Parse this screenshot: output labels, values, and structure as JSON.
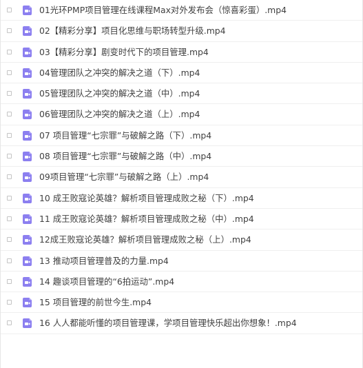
{
  "files": [
    {
      "name": "01光环PMP项目管理在线课程Max对外发布会（惊喜彩蛋）.mp4",
      "icon": "video-file-icon"
    },
    {
      "name": "02【精彩分享】项目化思维与职场转型升级.mp4",
      "icon": "video-file-icon"
    },
    {
      "name": "03【精彩分享】剧变时代下的项目管理.mp4",
      "icon": "video-file-icon"
    },
    {
      "name": "04管理团队之冲突的解决之道（下）.mp4",
      "icon": "video-file-icon"
    },
    {
      "name": "05管理团队之冲突的解决之道（中）.mp4",
      "icon": "video-file-icon"
    },
    {
      "name": "06管理团队之冲突的解决之道（上）.mp4",
      "icon": "video-file-icon"
    },
    {
      "name": "07 项目管理“七宗罪”与破解之路（下）.mp4",
      "icon": "video-file-icon"
    },
    {
      "name": "08 项目管理“七宗罪”与破解之路（中）.mp4",
      "icon": "video-file-icon"
    },
    {
      "name": "09项目管理“七宗罪”与破解之路（上）.mp4",
      "icon": "video-file-icon"
    },
    {
      "name": "10 成王败寇论英雄？解析项目管理成败之秘（下）.mp4",
      "icon": "video-file-icon"
    },
    {
      "name": "11 成王败寇论英雄？解析项目管理成败之秘（中）.mp4",
      "icon": "video-file-icon"
    },
    {
      "name": "12成王败寇论英雄？解析项目管理成败之秘（上）.mp4",
      "icon": "video-file-icon"
    },
    {
      "name": "13 推动项目管理普及的力量.mp4",
      "icon": "video-file-icon"
    },
    {
      "name": "14 趣谈项目管理的“6拍运动”.mp4",
      "icon": "video-file-icon"
    },
    {
      "name": "15 项目管理的前世今生.mp4",
      "icon": "video-file-icon"
    },
    {
      "name": "16 人人都能听懂的项目管理课，学项目管理快乐超出你想象！.mp4",
      "icon": "video-file-icon"
    }
  ],
  "colors": {
    "icon": "#8c7ff0",
    "text": "#3f3f3f",
    "divider": "#efefef"
  }
}
